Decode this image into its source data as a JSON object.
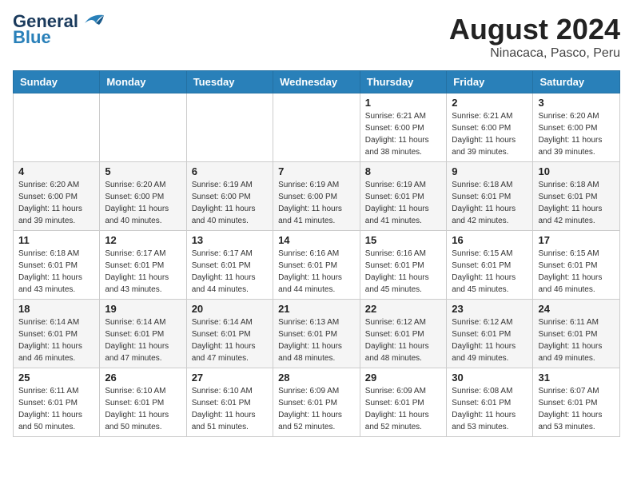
{
  "header": {
    "logo_line1": "General",
    "logo_line2": "Blue",
    "title": "August 2024",
    "subtitle": "Ninacaca, Pasco, Peru"
  },
  "weekdays": [
    "Sunday",
    "Monday",
    "Tuesday",
    "Wednesday",
    "Thursday",
    "Friday",
    "Saturday"
  ],
  "weeks": [
    [
      {
        "day": "",
        "info": ""
      },
      {
        "day": "",
        "info": ""
      },
      {
        "day": "",
        "info": ""
      },
      {
        "day": "",
        "info": ""
      },
      {
        "day": "1",
        "info": "Sunrise: 6:21 AM\nSunset: 6:00 PM\nDaylight: 11 hours\nand 38 minutes."
      },
      {
        "day": "2",
        "info": "Sunrise: 6:21 AM\nSunset: 6:00 PM\nDaylight: 11 hours\nand 39 minutes."
      },
      {
        "day": "3",
        "info": "Sunrise: 6:20 AM\nSunset: 6:00 PM\nDaylight: 11 hours\nand 39 minutes."
      }
    ],
    [
      {
        "day": "4",
        "info": "Sunrise: 6:20 AM\nSunset: 6:00 PM\nDaylight: 11 hours\nand 39 minutes."
      },
      {
        "day": "5",
        "info": "Sunrise: 6:20 AM\nSunset: 6:00 PM\nDaylight: 11 hours\nand 40 minutes."
      },
      {
        "day": "6",
        "info": "Sunrise: 6:19 AM\nSunset: 6:00 PM\nDaylight: 11 hours\nand 40 minutes."
      },
      {
        "day": "7",
        "info": "Sunrise: 6:19 AM\nSunset: 6:00 PM\nDaylight: 11 hours\nand 41 minutes."
      },
      {
        "day": "8",
        "info": "Sunrise: 6:19 AM\nSunset: 6:01 PM\nDaylight: 11 hours\nand 41 minutes."
      },
      {
        "day": "9",
        "info": "Sunrise: 6:18 AM\nSunset: 6:01 PM\nDaylight: 11 hours\nand 42 minutes."
      },
      {
        "day": "10",
        "info": "Sunrise: 6:18 AM\nSunset: 6:01 PM\nDaylight: 11 hours\nand 42 minutes."
      }
    ],
    [
      {
        "day": "11",
        "info": "Sunrise: 6:18 AM\nSunset: 6:01 PM\nDaylight: 11 hours\nand 43 minutes."
      },
      {
        "day": "12",
        "info": "Sunrise: 6:17 AM\nSunset: 6:01 PM\nDaylight: 11 hours\nand 43 minutes."
      },
      {
        "day": "13",
        "info": "Sunrise: 6:17 AM\nSunset: 6:01 PM\nDaylight: 11 hours\nand 44 minutes."
      },
      {
        "day": "14",
        "info": "Sunrise: 6:16 AM\nSunset: 6:01 PM\nDaylight: 11 hours\nand 44 minutes."
      },
      {
        "day": "15",
        "info": "Sunrise: 6:16 AM\nSunset: 6:01 PM\nDaylight: 11 hours\nand 45 minutes."
      },
      {
        "day": "16",
        "info": "Sunrise: 6:15 AM\nSunset: 6:01 PM\nDaylight: 11 hours\nand 45 minutes."
      },
      {
        "day": "17",
        "info": "Sunrise: 6:15 AM\nSunset: 6:01 PM\nDaylight: 11 hours\nand 46 minutes."
      }
    ],
    [
      {
        "day": "18",
        "info": "Sunrise: 6:14 AM\nSunset: 6:01 PM\nDaylight: 11 hours\nand 46 minutes."
      },
      {
        "day": "19",
        "info": "Sunrise: 6:14 AM\nSunset: 6:01 PM\nDaylight: 11 hours\nand 47 minutes."
      },
      {
        "day": "20",
        "info": "Sunrise: 6:14 AM\nSunset: 6:01 PM\nDaylight: 11 hours\nand 47 minutes."
      },
      {
        "day": "21",
        "info": "Sunrise: 6:13 AM\nSunset: 6:01 PM\nDaylight: 11 hours\nand 48 minutes."
      },
      {
        "day": "22",
        "info": "Sunrise: 6:12 AM\nSunset: 6:01 PM\nDaylight: 11 hours\nand 48 minutes."
      },
      {
        "day": "23",
        "info": "Sunrise: 6:12 AM\nSunset: 6:01 PM\nDaylight: 11 hours\nand 49 minutes."
      },
      {
        "day": "24",
        "info": "Sunrise: 6:11 AM\nSunset: 6:01 PM\nDaylight: 11 hours\nand 49 minutes."
      }
    ],
    [
      {
        "day": "25",
        "info": "Sunrise: 6:11 AM\nSunset: 6:01 PM\nDaylight: 11 hours\nand 50 minutes."
      },
      {
        "day": "26",
        "info": "Sunrise: 6:10 AM\nSunset: 6:01 PM\nDaylight: 11 hours\nand 50 minutes."
      },
      {
        "day": "27",
        "info": "Sunrise: 6:10 AM\nSunset: 6:01 PM\nDaylight: 11 hours\nand 51 minutes."
      },
      {
        "day": "28",
        "info": "Sunrise: 6:09 AM\nSunset: 6:01 PM\nDaylight: 11 hours\nand 52 minutes."
      },
      {
        "day": "29",
        "info": "Sunrise: 6:09 AM\nSunset: 6:01 PM\nDaylight: 11 hours\nand 52 minutes."
      },
      {
        "day": "30",
        "info": "Sunrise: 6:08 AM\nSunset: 6:01 PM\nDaylight: 11 hours\nand 53 minutes."
      },
      {
        "day": "31",
        "info": "Sunrise: 6:07 AM\nSunset: 6:01 PM\nDaylight: 11 hours\nand 53 minutes."
      }
    ]
  ]
}
